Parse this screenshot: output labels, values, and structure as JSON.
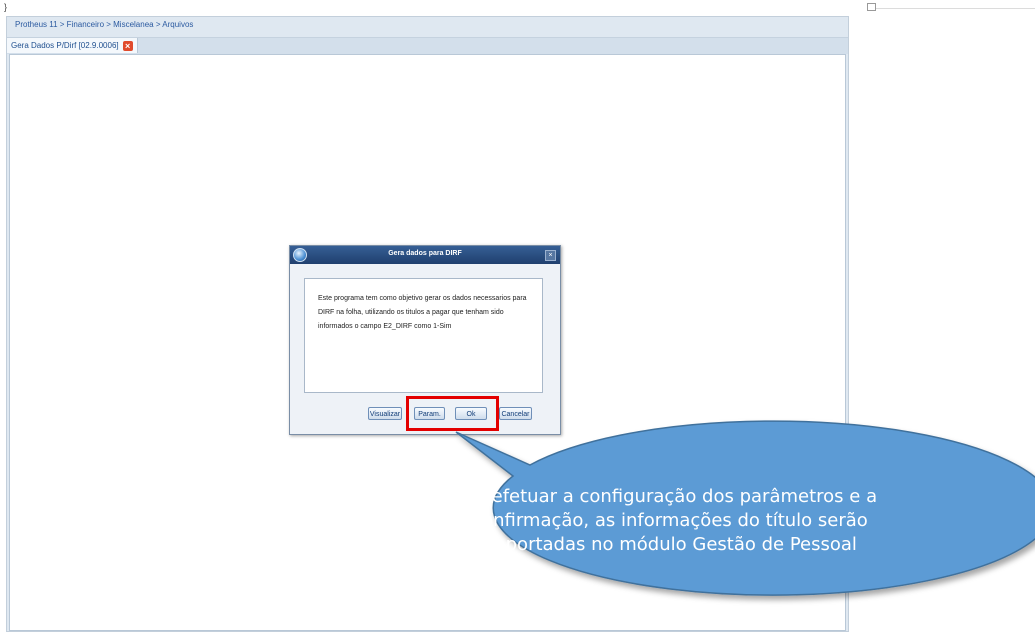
{
  "top_stub": "}",
  "breadcrumb": "Protheus 11 > Financeiro > Miscelanea > Arquivos",
  "tab": {
    "label": "Gera Dados P/Dirf [02.9.0006]",
    "close_glyph": "×"
  },
  "dialog": {
    "title": "Gera dados para DIRF",
    "close_glyph": "×",
    "message": "Este programa tem como objetivo gerar os dados necessarios para DIRF na folha, utilizando os titulos a pagar que tenham sido informados o campo E2_DIRF como 1-Sim",
    "buttons": {
      "visualizar": "Visualizar",
      "param": "Param.",
      "ok": "Ok",
      "cancelar": "Cancelar"
    }
  },
  "callout": {
    "text": "Ao efetuar a configuração dos parâmetros e a confirmação, as informações do título serão importadas no módulo Gestão de Pessoal",
    "fill_color": "#5b9bd5",
    "border_color": "#41719c"
  },
  "highlight_color": "#e30000",
  "icons": [
    "close-icon",
    "app-logo-icon",
    "window-restore-icon"
  ]
}
